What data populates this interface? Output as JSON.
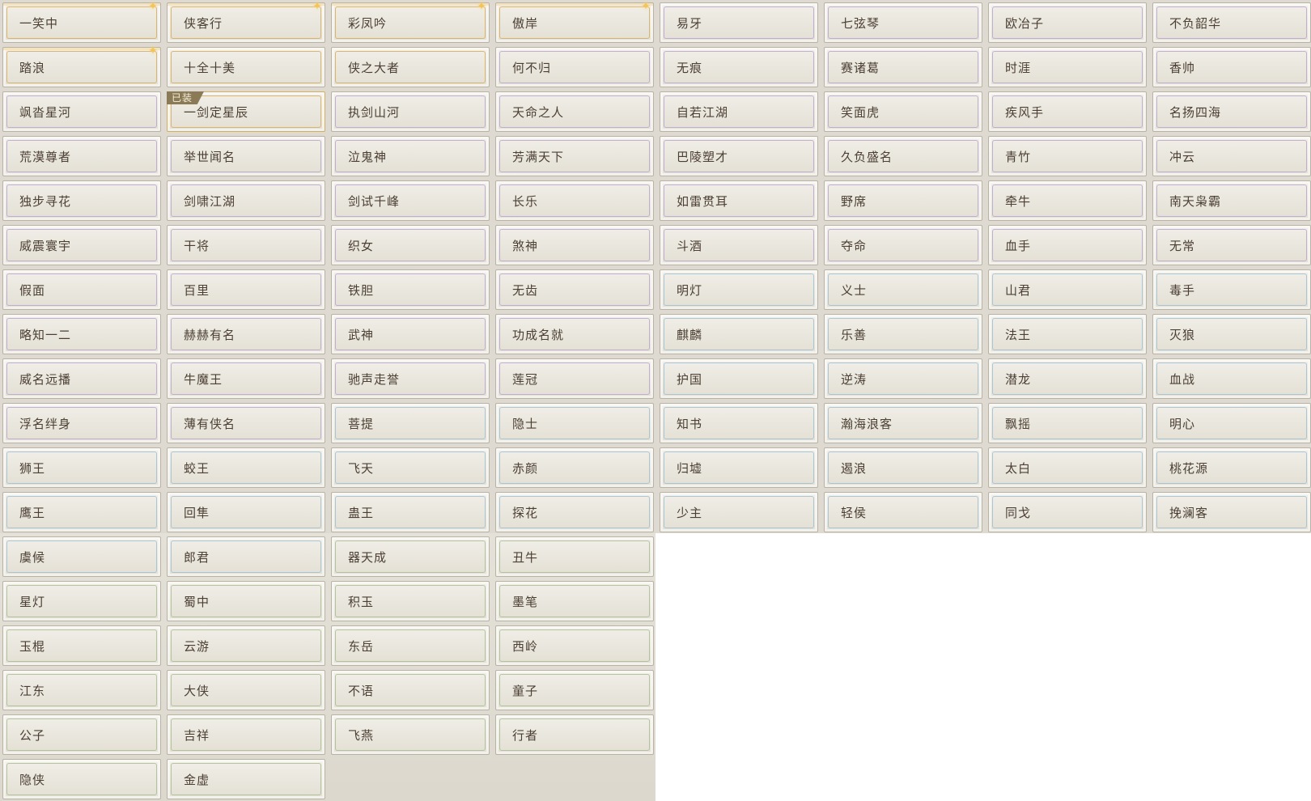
{
  "equipped_badge": "已装",
  "colors": {
    "gold": "#d6ad5a",
    "purple": "#b9a5cf",
    "blue": "#9fc0d2",
    "green": "#a9bd92",
    "text": "#4b3f33"
  },
  "titles": [
    {
      "label": "一笑中",
      "tier": "gold",
      "sparkle": true
    },
    {
      "label": "侠客行",
      "tier": "gold",
      "sparkle": true
    },
    {
      "label": "彩凤吟",
      "tier": "gold",
      "sparkle": true
    },
    {
      "label": "傲岸",
      "tier": "gold",
      "sparkle": true
    },
    {
      "label": "易牙",
      "tier": "purple"
    },
    {
      "label": "七弦琴",
      "tier": "purple"
    },
    {
      "label": "欧冶子",
      "tier": "purple"
    },
    {
      "label": "不负韶华",
      "tier": "purple"
    },
    {
      "label": "踏浪",
      "tier": "gold",
      "sparkle": true
    },
    {
      "label": "十全十美",
      "tier": "gold"
    },
    {
      "label": "侠之大者",
      "tier": "gold"
    },
    {
      "label": "何不归",
      "tier": "purple"
    },
    {
      "label": "无痕",
      "tier": "purple"
    },
    {
      "label": "赛诸葛",
      "tier": "purple"
    },
    {
      "label": "时涯",
      "tier": "purple"
    },
    {
      "label": "香帅",
      "tier": "purple"
    },
    {
      "label": "飒沓星河",
      "tier": "purple"
    },
    {
      "label": "一剑定星辰",
      "tier": "gold",
      "equipped": true
    },
    {
      "label": "执剑山河",
      "tier": "purple"
    },
    {
      "label": "天命之人",
      "tier": "purple"
    },
    {
      "label": "自若江湖",
      "tier": "purple"
    },
    {
      "label": "笑面虎",
      "tier": "purple"
    },
    {
      "label": "疾风手",
      "tier": "purple"
    },
    {
      "label": "名扬四海",
      "tier": "purple"
    },
    {
      "label": "荒漠尊者",
      "tier": "purple"
    },
    {
      "label": "举世闻名",
      "tier": "purple"
    },
    {
      "label": "泣鬼神",
      "tier": "purple"
    },
    {
      "label": "芳满天下",
      "tier": "purple"
    },
    {
      "label": "巴陵塑才",
      "tier": "purple"
    },
    {
      "label": "久负盛名",
      "tier": "purple"
    },
    {
      "label": "青竹",
      "tier": "purple"
    },
    {
      "label": "冲云",
      "tier": "purple"
    },
    {
      "label": "独步寻花",
      "tier": "purple"
    },
    {
      "label": "剑啸江湖",
      "tier": "purple"
    },
    {
      "label": "剑试千峰",
      "tier": "purple"
    },
    {
      "label": "长乐",
      "tier": "purple"
    },
    {
      "label": "如雷贯耳",
      "tier": "purple"
    },
    {
      "label": "野席",
      "tier": "purple"
    },
    {
      "label": "牵牛",
      "tier": "purple"
    },
    {
      "label": "南天枭霸",
      "tier": "purple"
    },
    {
      "label": "威震寰宇",
      "tier": "purple"
    },
    {
      "label": "干将",
      "tier": "purple"
    },
    {
      "label": "织女",
      "tier": "purple"
    },
    {
      "label": "煞神",
      "tier": "purple"
    },
    {
      "label": "斗酒",
      "tier": "purple"
    },
    {
      "label": "夺命",
      "tier": "purple"
    },
    {
      "label": "血手",
      "tier": "purple"
    },
    {
      "label": "无常",
      "tier": "purple"
    },
    {
      "label": "假面",
      "tier": "purple"
    },
    {
      "label": "百里",
      "tier": "purple"
    },
    {
      "label": "铁胆",
      "tier": "purple"
    },
    {
      "label": "无齿",
      "tier": "purple"
    },
    {
      "label": "明灯",
      "tier": "blue"
    },
    {
      "label": "义士",
      "tier": "blue"
    },
    {
      "label": "山君",
      "tier": "blue"
    },
    {
      "label": "毒手",
      "tier": "blue"
    },
    {
      "label": "略知一二",
      "tier": "purple"
    },
    {
      "label": "赫赫有名",
      "tier": "purple"
    },
    {
      "label": "武神",
      "tier": "purple"
    },
    {
      "label": "功成名就",
      "tier": "purple"
    },
    {
      "label": "麒麟",
      "tier": "blue"
    },
    {
      "label": "乐善",
      "tier": "blue"
    },
    {
      "label": "法王",
      "tier": "blue"
    },
    {
      "label": "灭狼",
      "tier": "blue"
    },
    {
      "label": "威名远播",
      "tier": "purple"
    },
    {
      "label": "牛魔王",
      "tier": "purple"
    },
    {
      "label": "驰声走誉",
      "tier": "purple"
    },
    {
      "label": "莲冠",
      "tier": "purple"
    },
    {
      "label": "护国",
      "tier": "blue"
    },
    {
      "label": "逆涛",
      "tier": "blue"
    },
    {
      "label": "潜龙",
      "tier": "blue"
    },
    {
      "label": "血战",
      "tier": "blue"
    },
    {
      "label": "浮名绊身",
      "tier": "purple"
    },
    {
      "label": "薄有侠名",
      "tier": "purple"
    },
    {
      "label": "菩提",
      "tier": "blue"
    },
    {
      "label": "隐士",
      "tier": "blue"
    },
    {
      "label": "知书",
      "tier": "blue"
    },
    {
      "label": "瀚海浪客",
      "tier": "blue"
    },
    {
      "label": "飘摇",
      "tier": "blue"
    },
    {
      "label": "明心",
      "tier": "blue"
    },
    {
      "label": "狮王",
      "tier": "blue"
    },
    {
      "label": "蛟王",
      "tier": "blue"
    },
    {
      "label": "飞天",
      "tier": "blue"
    },
    {
      "label": "赤颜",
      "tier": "blue"
    },
    {
      "label": "归墟",
      "tier": "blue"
    },
    {
      "label": "遏浪",
      "tier": "blue"
    },
    {
      "label": "太白",
      "tier": "blue"
    },
    {
      "label": "桃花源",
      "tier": "blue"
    },
    {
      "label": "鹰王",
      "tier": "blue"
    },
    {
      "label": "回隼",
      "tier": "blue"
    },
    {
      "label": "蛊王",
      "tier": "blue"
    },
    {
      "label": "探花",
      "tier": "blue"
    },
    {
      "label": "少主",
      "tier": "blue"
    },
    {
      "label": "轻侯",
      "tier": "blue"
    },
    {
      "label": "同戈",
      "tier": "blue"
    },
    {
      "label": "挽澜客",
      "tier": "blue"
    },
    {
      "label": "虞候",
      "tier": "blue"
    },
    {
      "label": "郎君",
      "tier": "blue"
    },
    {
      "label": "器天成",
      "tier": "green"
    },
    {
      "label": "丑牛",
      "tier": "green"
    },
    {
      "label": "星灯",
      "tier": "green"
    },
    {
      "label": "蜀中",
      "tier": "green"
    },
    {
      "label": "积玉",
      "tier": "green"
    },
    {
      "label": "墨笔",
      "tier": "green"
    },
    {
      "label": "玉棍",
      "tier": "green"
    },
    {
      "label": "云游",
      "tier": "green"
    },
    {
      "label": "东岳",
      "tier": "green"
    },
    {
      "label": "西岭",
      "tier": "green"
    },
    {
      "label": "江东",
      "tier": "green"
    },
    {
      "label": "大侠",
      "tier": "green"
    },
    {
      "label": "不语",
      "tier": "green"
    },
    {
      "label": "童子",
      "tier": "green"
    },
    {
      "label": "公子",
      "tier": "green"
    },
    {
      "label": "吉祥",
      "tier": "green"
    },
    {
      "label": "飞燕",
      "tier": "green"
    },
    {
      "label": "行者",
      "tier": "green"
    },
    {
      "label": "隐侠",
      "tier": "green"
    },
    {
      "label": "金虚",
      "tier": "green"
    }
  ]
}
